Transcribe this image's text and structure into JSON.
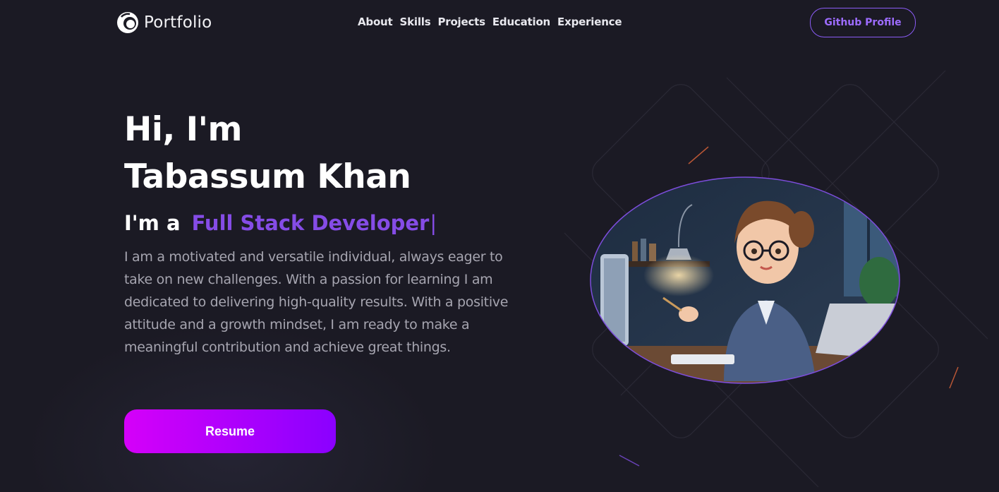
{
  "nav": {
    "logo_text": "Portfolio",
    "links": [
      "About",
      "Skills",
      "Projects",
      "Education",
      "Experience"
    ],
    "github_label": "Github Profile"
  },
  "hero": {
    "greeting": "Hi, I'm",
    "name": "Tabassum Khan",
    "role_prefix": "I'm a",
    "role": "Full Stack Developer",
    "cursor": "|",
    "bio": "I am a motivated and versatile individual, always eager to take on new challenges. With a passion for learning I am dedicated to delivering high-quality results. With a positive attitude and a growth mindset, I am ready to make a meaningful contribution and achieve great things.",
    "resume_label": "Resume"
  },
  "colors": {
    "background": "#1b1a24",
    "accent": "#854ce6",
    "resume_gradient_start": "#d500f9",
    "resume_gradient_end": "#8a00ff",
    "bio_text": "#a6a5b0"
  },
  "icons": {
    "logo": "ring-logo-icon",
    "avatar": "developer-avatar-illustration"
  }
}
